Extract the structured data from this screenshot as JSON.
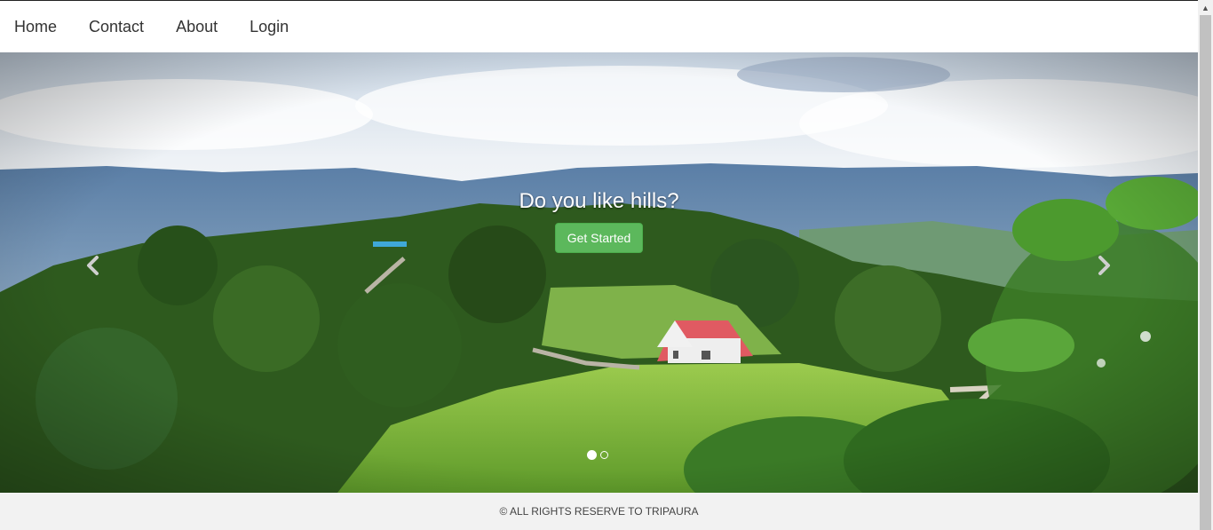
{
  "nav": {
    "items": [
      {
        "label": "Home"
      },
      {
        "label": "Contact"
      },
      {
        "label": "About"
      },
      {
        "label": "Login"
      }
    ]
  },
  "hero": {
    "caption": "Do you like hills?",
    "cta_label": "Get Started",
    "slide_count": 2,
    "active_slide": 1
  },
  "footer": {
    "text": "© ALL RIGHTS RESERVE TO TRIPAURA"
  },
  "colors": {
    "cta": "#5cb85c",
    "footer_bg": "#f2f2f2"
  }
}
